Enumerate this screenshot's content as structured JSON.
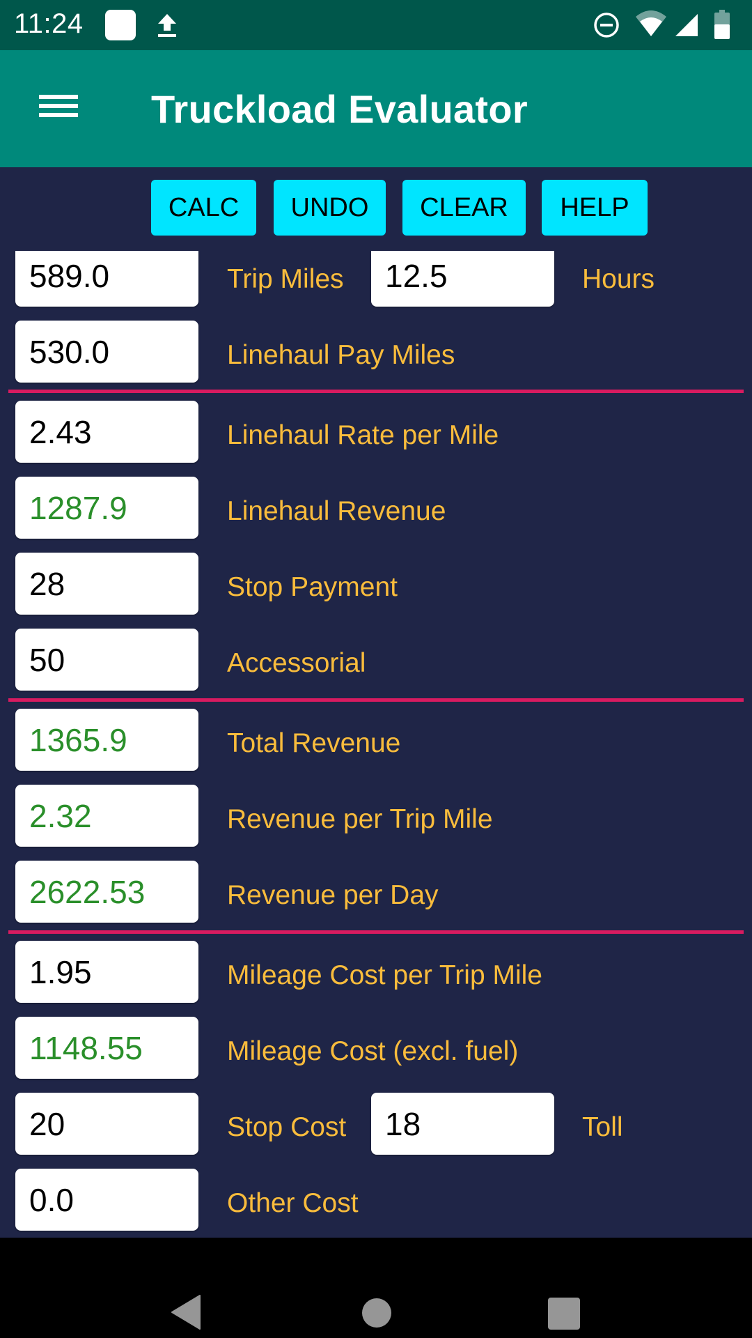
{
  "status_bar": {
    "time": "11:24",
    "icons": [
      "notification-square-icon",
      "upload-icon",
      "do-not-disturb-icon",
      "wifi-icon",
      "cellular-signal-icon",
      "battery-icon"
    ],
    "battery_level_percent": 55
  },
  "app_bar": {
    "title": "Truckload Evaluator",
    "menu_icon": "hamburger-menu-icon"
  },
  "toolbar": {
    "buttons": [
      {
        "id": "calc",
        "label": "CALC"
      },
      {
        "id": "undo",
        "label": "UNDO"
      },
      {
        "id": "clear",
        "label": "CLEAR"
      },
      {
        "id": "help",
        "label": "HELP"
      }
    ]
  },
  "form": {
    "trip_miles": {
      "value": "589.0",
      "label": "Trip Miles"
    },
    "hours": {
      "value": "12.5",
      "label": "Hours"
    },
    "linehaul_pay_miles": {
      "value": "530.0",
      "label": "Linehaul Pay Miles"
    },
    "linehaul_rate_per_mile": {
      "value": "2.43",
      "label": "Linehaul Rate per Mile"
    },
    "linehaul_revenue": {
      "value": "1287.9",
      "label": "Linehaul Revenue"
    },
    "stop_payment": {
      "value": "28",
      "label": "Stop Payment"
    },
    "accessorial": {
      "value": "50",
      "label": "Accessorial"
    },
    "total_revenue": {
      "value": "1365.9",
      "label": "Total Revenue"
    },
    "revenue_per_trip_mile": {
      "value": "2.32",
      "label": "Revenue per Trip Mile"
    },
    "revenue_per_day": {
      "value": "2622.53",
      "label": "Revenue per Day"
    },
    "mileage_cost_per_trip_mile": {
      "value": "1.95",
      "label": "Mileage Cost per Trip Mile"
    },
    "mileage_cost": {
      "value": "1148.55",
      "label": "Mileage Cost (excl. fuel)"
    },
    "stop_cost": {
      "value": "20",
      "label": "Stop Cost"
    },
    "toll": {
      "value": "18",
      "label": "Toll"
    },
    "other_cost": {
      "value": "0.0",
      "label": "Other Cost"
    }
  },
  "colors": {
    "status_bar": "#00574B",
    "app_bar": "#00897B",
    "background": "#1F2547",
    "button": "#00E5FF",
    "label": "#F9BC3C",
    "calculated_value": "#2A8F2A",
    "divider": "#D81B60"
  },
  "nav_bar": {
    "icons": [
      "back-icon",
      "home-icon",
      "recent-apps-icon"
    ]
  }
}
